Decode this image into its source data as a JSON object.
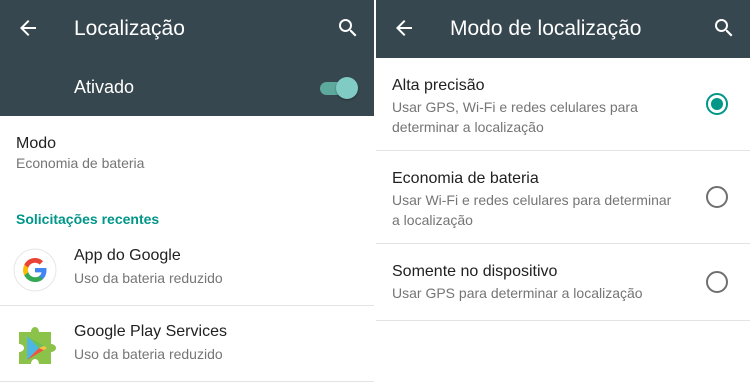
{
  "left": {
    "appbar": {
      "title": "Localização",
      "back_icon": "arrow-left-icon",
      "search_icon": "search-icon"
    },
    "master_switch": {
      "label": "Ativado",
      "state": "on",
      "accent": "#80cbc4"
    },
    "mode": {
      "title": "Modo",
      "value": "Economia de bateria"
    },
    "recent_header": "Solicitações recentes",
    "recent_apps": [
      {
        "name": "App do Google",
        "detail": "Uso da bateria reduzido",
        "icon": "google-g-icon"
      },
      {
        "name": "Google Play Services",
        "detail": "Uso da bateria reduzido",
        "icon": "play-services-puzzle-icon"
      }
    ]
  },
  "right": {
    "appbar": {
      "title": "Modo de localização",
      "back_icon": "arrow-left-icon",
      "search_icon": "search-icon"
    },
    "options": [
      {
        "title": "Alta precisão",
        "line1": "Usar GPS, Wi-Fi e redes celulares para",
        "line2": "determinar a localização",
        "selected": true
      },
      {
        "title": "Economia de bateria",
        "line1": "Usar Wi-Fi e redes celulares para determinar",
        "line2": "a localização",
        "selected": false
      },
      {
        "title": "Somente no dispositivo",
        "line1": "Usar GPS para determinar a localização",
        "line2": "",
        "selected": false
      }
    ]
  },
  "colors": {
    "appbar": "#37474f",
    "accent": "#009688",
    "primary_text": "#212121",
    "secondary_text": "#757575"
  }
}
